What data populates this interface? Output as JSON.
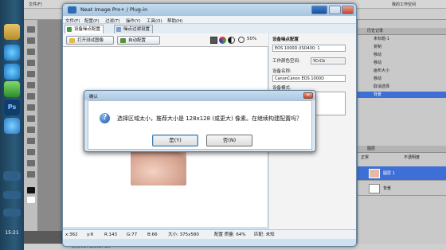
{
  "taskbar": {
    "clock": "15:21",
    "icons": [
      "folder-icon",
      "ie-icon",
      "ie-icon",
      "shield-icon",
      "photoshop-icon",
      "ie-icon"
    ]
  },
  "photoshop": {
    "menu": [
      "文件(F)",
      "编辑",
      "图像",
      "图层",
      "选择",
      "滤镜",
      "分析",
      "视图",
      "窗口",
      "帮助"
    ],
    "workspace_label": "我的工作空间",
    "history_items": [
      "未标题-1",
      "复制",
      "移动",
      "移动",
      "画布大小",
      "移动",
      "取消选择",
      "背景"
    ],
    "blend_mode": "正常",
    "opacity_label": "不透明度",
    "layers": [
      "图层 1",
      "背景"
    ],
    "status": "文档:617.2K/617.2K"
  },
  "neat_image": {
    "title": "Neat Image Pro+ / Plug-in",
    "menu": [
      "文件(F)",
      "配置(P)",
      "过滤(T)",
      "操作(Y)",
      "工具(O)",
      "帮助(H)"
    ],
    "tabs": [
      "设备噪点配置",
      "噪点过滤设置"
    ],
    "toolbar": {
      "open_test_image": "打开测试图像",
      "auto_profile": "自动配置",
      "zoom": "50%"
    },
    "side": {
      "header": "设备噪点配置",
      "camera_field": "EOS 1000D (ISO400; 1",
      "color_space_label": "工作颜色空间:",
      "color_space_value": "YCrCb",
      "device_name_label": "设备名称:",
      "device_name_value": "CanonCanon EOS 1000D",
      "device_mode_label": "设备模式:",
      "device_mode_value": "ISO 感光: 400"
    },
    "status": {
      "x": "x:362",
      "y": "y:6",
      "r": "R:143",
      "g": "G:77",
      "b": "B:66",
      "size": "大小: 375x580",
      "profile": "配置 质量: 64%",
      "zone": "匹配: 未知"
    }
  },
  "dialog": {
    "title": "确认",
    "message": "选择区域太小，推荐大小是 128x128 (或更大) 像素。在继续构建配置吗？",
    "yes_label": "是(Y)",
    "no_label": "否(N)"
  }
}
